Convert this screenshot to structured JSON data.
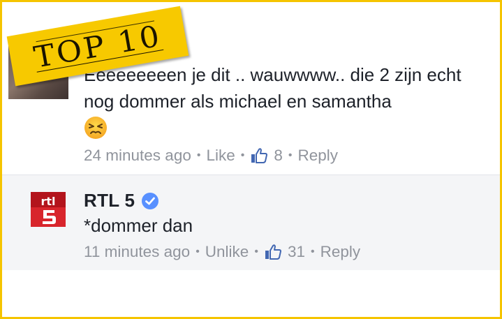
{
  "badge": {
    "label": "TOP 10"
  },
  "comment1": {
    "text": "Eeeeeeeeen je dit .. wauwwww.. die 2 zijn echt nog dommer als michael en samantha",
    "emoji": "persevering-face",
    "time": "24 minutes ago",
    "like_label": "Like",
    "like_count": "8",
    "reply_label": "Reply"
  },
  "comment2": {
    "author": "RTL 5",
    "verified": true,
    "text": "*dommer dan",
    "time": "11 minutes ago",
    "like_label": "Unlike",
    "like_count": "31",
    "reply_label": "Reply"
  },
  "colors": {
    "frame": "#f5c400",
    "badge": "#f7c900",
    "link": "#90949c",
    "like_blue": "#4267b2",
    "verified_blue": "#5890ff",
    "rtl_red": "#b3141c"
  }
}
